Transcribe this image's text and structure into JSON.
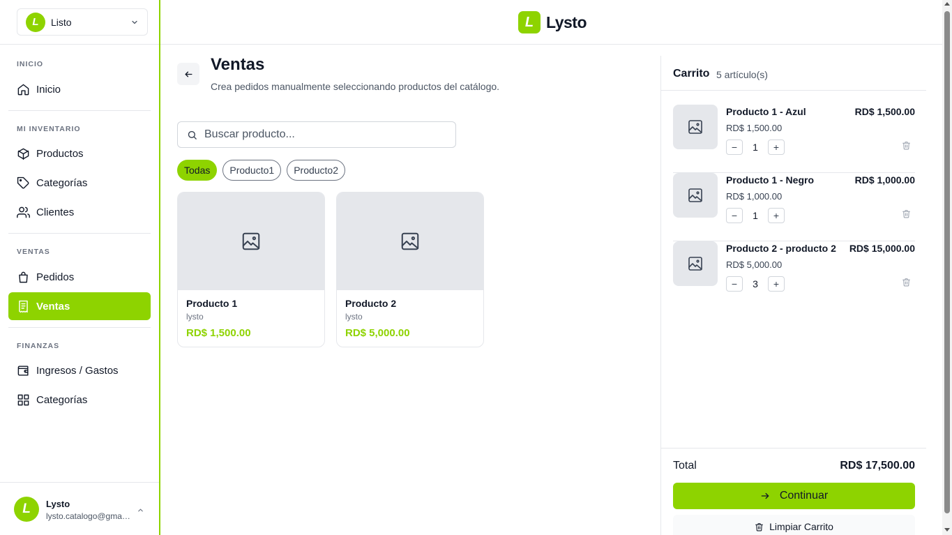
{
  "store_switcher": {
    "name": "Listo",
    "logo_letter": "L"
  },
  "brand": {
    "name": "Lysto",
    "logo_letter": "L"
  },
  "sidebar": {
    "sections": [
      {
        "label": "INICIO"
      },
      {
        "label": "MI INVENTARIO"
      },
      {
        "label": "VENTAS"
      },
      {
        "label": "FINANZAS"
      }
    ],
    "items": [
      {
        "label": "Inicio",
        "icon": "home-icon"
      },
      {
        "label": "Productos",
        "icon": "box-icon"
      },
      {
        "label": "Categorías",
        "icon": "tag-icon"
      },
      {
        "label": "Clientes",
        "icon": "users-icon"
      },
      {
        "label": "Pedidos",
        "icon": "shopping-bag-icon"
      },
      {
        "label": "Ventas",
        "icon": "receipt-icon",
        "active": true
      },
      {
        "label": "Ingresos / Gastos",
        "icon": "wallet-icon"
      },
      {
        "label": "Categorías",
        "icon": "grid-icon"
      }
    ]
  },
  "user": {
    "name": "Lysto",
    "email": "lysto.catalogo@gmail.com",
    "avatar_letter": "L"
  },
  "page": {
    "title": "Ventas",
    "subtitle": "Crea pedidos manualmente seleccionando productos del catálogo."
  },
  "search": {
    "placeholder": "Buscar producto...",
    "value": ""
  },
  "filters": [
    {
      "label": "Todas",
      "active": true
    },
    {
      "label": "Producto1",
      "active": false
    },
    {
      "label": "Producto2",
      "active": false
    }
  ],
  "products": [
    {
      "name": "Producto 1",
      "brand": "lysto",
      "price": "RD$ 1,500.00"
    },
    {
      "name": "Producto 2",
      "brand": "lysto",
      "price": "RD$ 5,000.00"
    }
  ],
  "cart": {
    "title": "Carrito",
    "count_text": "5 artículo(s)",
    "items": [
      {
        "name": "Producto 1 - Azul",
        "unit_price": "RD$ 1,500.00",
        "line_total": "RD$ 1,500.00",
        "quantity": "1"
      },
      {
        "name": "Producto 1 - Negro",
        "unit_price": "RD$ 1,000.00",
        "line_total": "RD$ 1,000.00",
        "quantity": "1"
      },
      {
        "name": "Producto 2 - producto 2",
        "unit_price": "RD$ 5,000.00",
        "line_total": "RD$ 15,000.00",
        "quantity": "3"
      }
    ],
    "total_label": "Total",
    "total_value": "RD$ 17,500.00",
    "continue_label": "Continuar",
    "clear_label": "Limpiar Carrito"
  },
  "colors": {
    "accent": "#8ED300",
    "border": "#e5e7eb",
    "placeholder_bg": "#e5e7eb"
  }
}
